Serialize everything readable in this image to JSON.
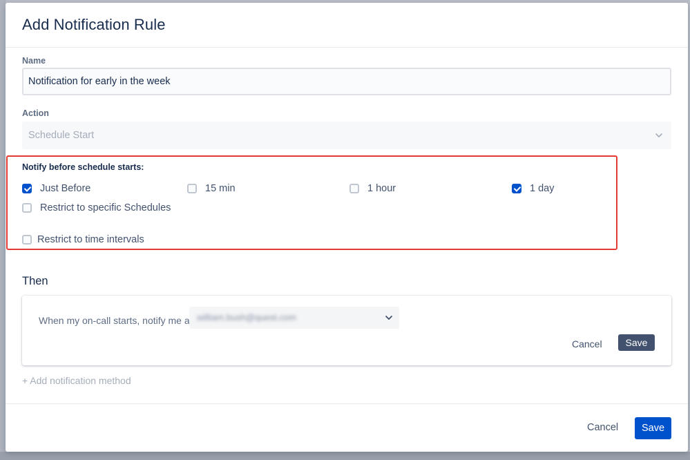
{
  "dialog": {
    "title": "Add Notification Rule"
  },
  "form": {
    "name_label": "Name",
    "name_value": "Notification for early in the week",
    "action_label": "Action",
    "action_value": "Schedule Start",
    "notify_label": "Notify before schedule starts:",
    "options": [
      {
        "label": "Just Before",
        "checked": true
      },
      {
        "label": "15 min",
        "checked": false
      },
      {
        "label": "1 hour",
        "checked": false
      },
      {
        "label": "1 day",
        "checked": true
      },
      {
        "label": "Restrict to specific Schedules",
        "checked": false
      },
      {
        "label": "Restrict to time intervals",
        "checked": false
      }
    ]
  },
  "then": {
    "title": "Then",
    "text": "When my on-call starts, notify me at",
    "email_value": "william.bush@quest.com",
    "cancel_label": "Cancel",
    "save_label": "Save",
    "add_method_label": "+ Add notification method"
  },
  "footer": {
    "cancel_label": "Cancel",
    "save_label": "Save"
  },
  "colors": {
    "primary": "#0052cc",
    "secondary_button": "#42526e",
    "highlight": "#e53935",
    "text": "#172b4d",
    "muted": "#a5adba"
  },
  "icons": {
    "chevron": "chevron-down-icon",
    "check": "check-icon"
  }
}
